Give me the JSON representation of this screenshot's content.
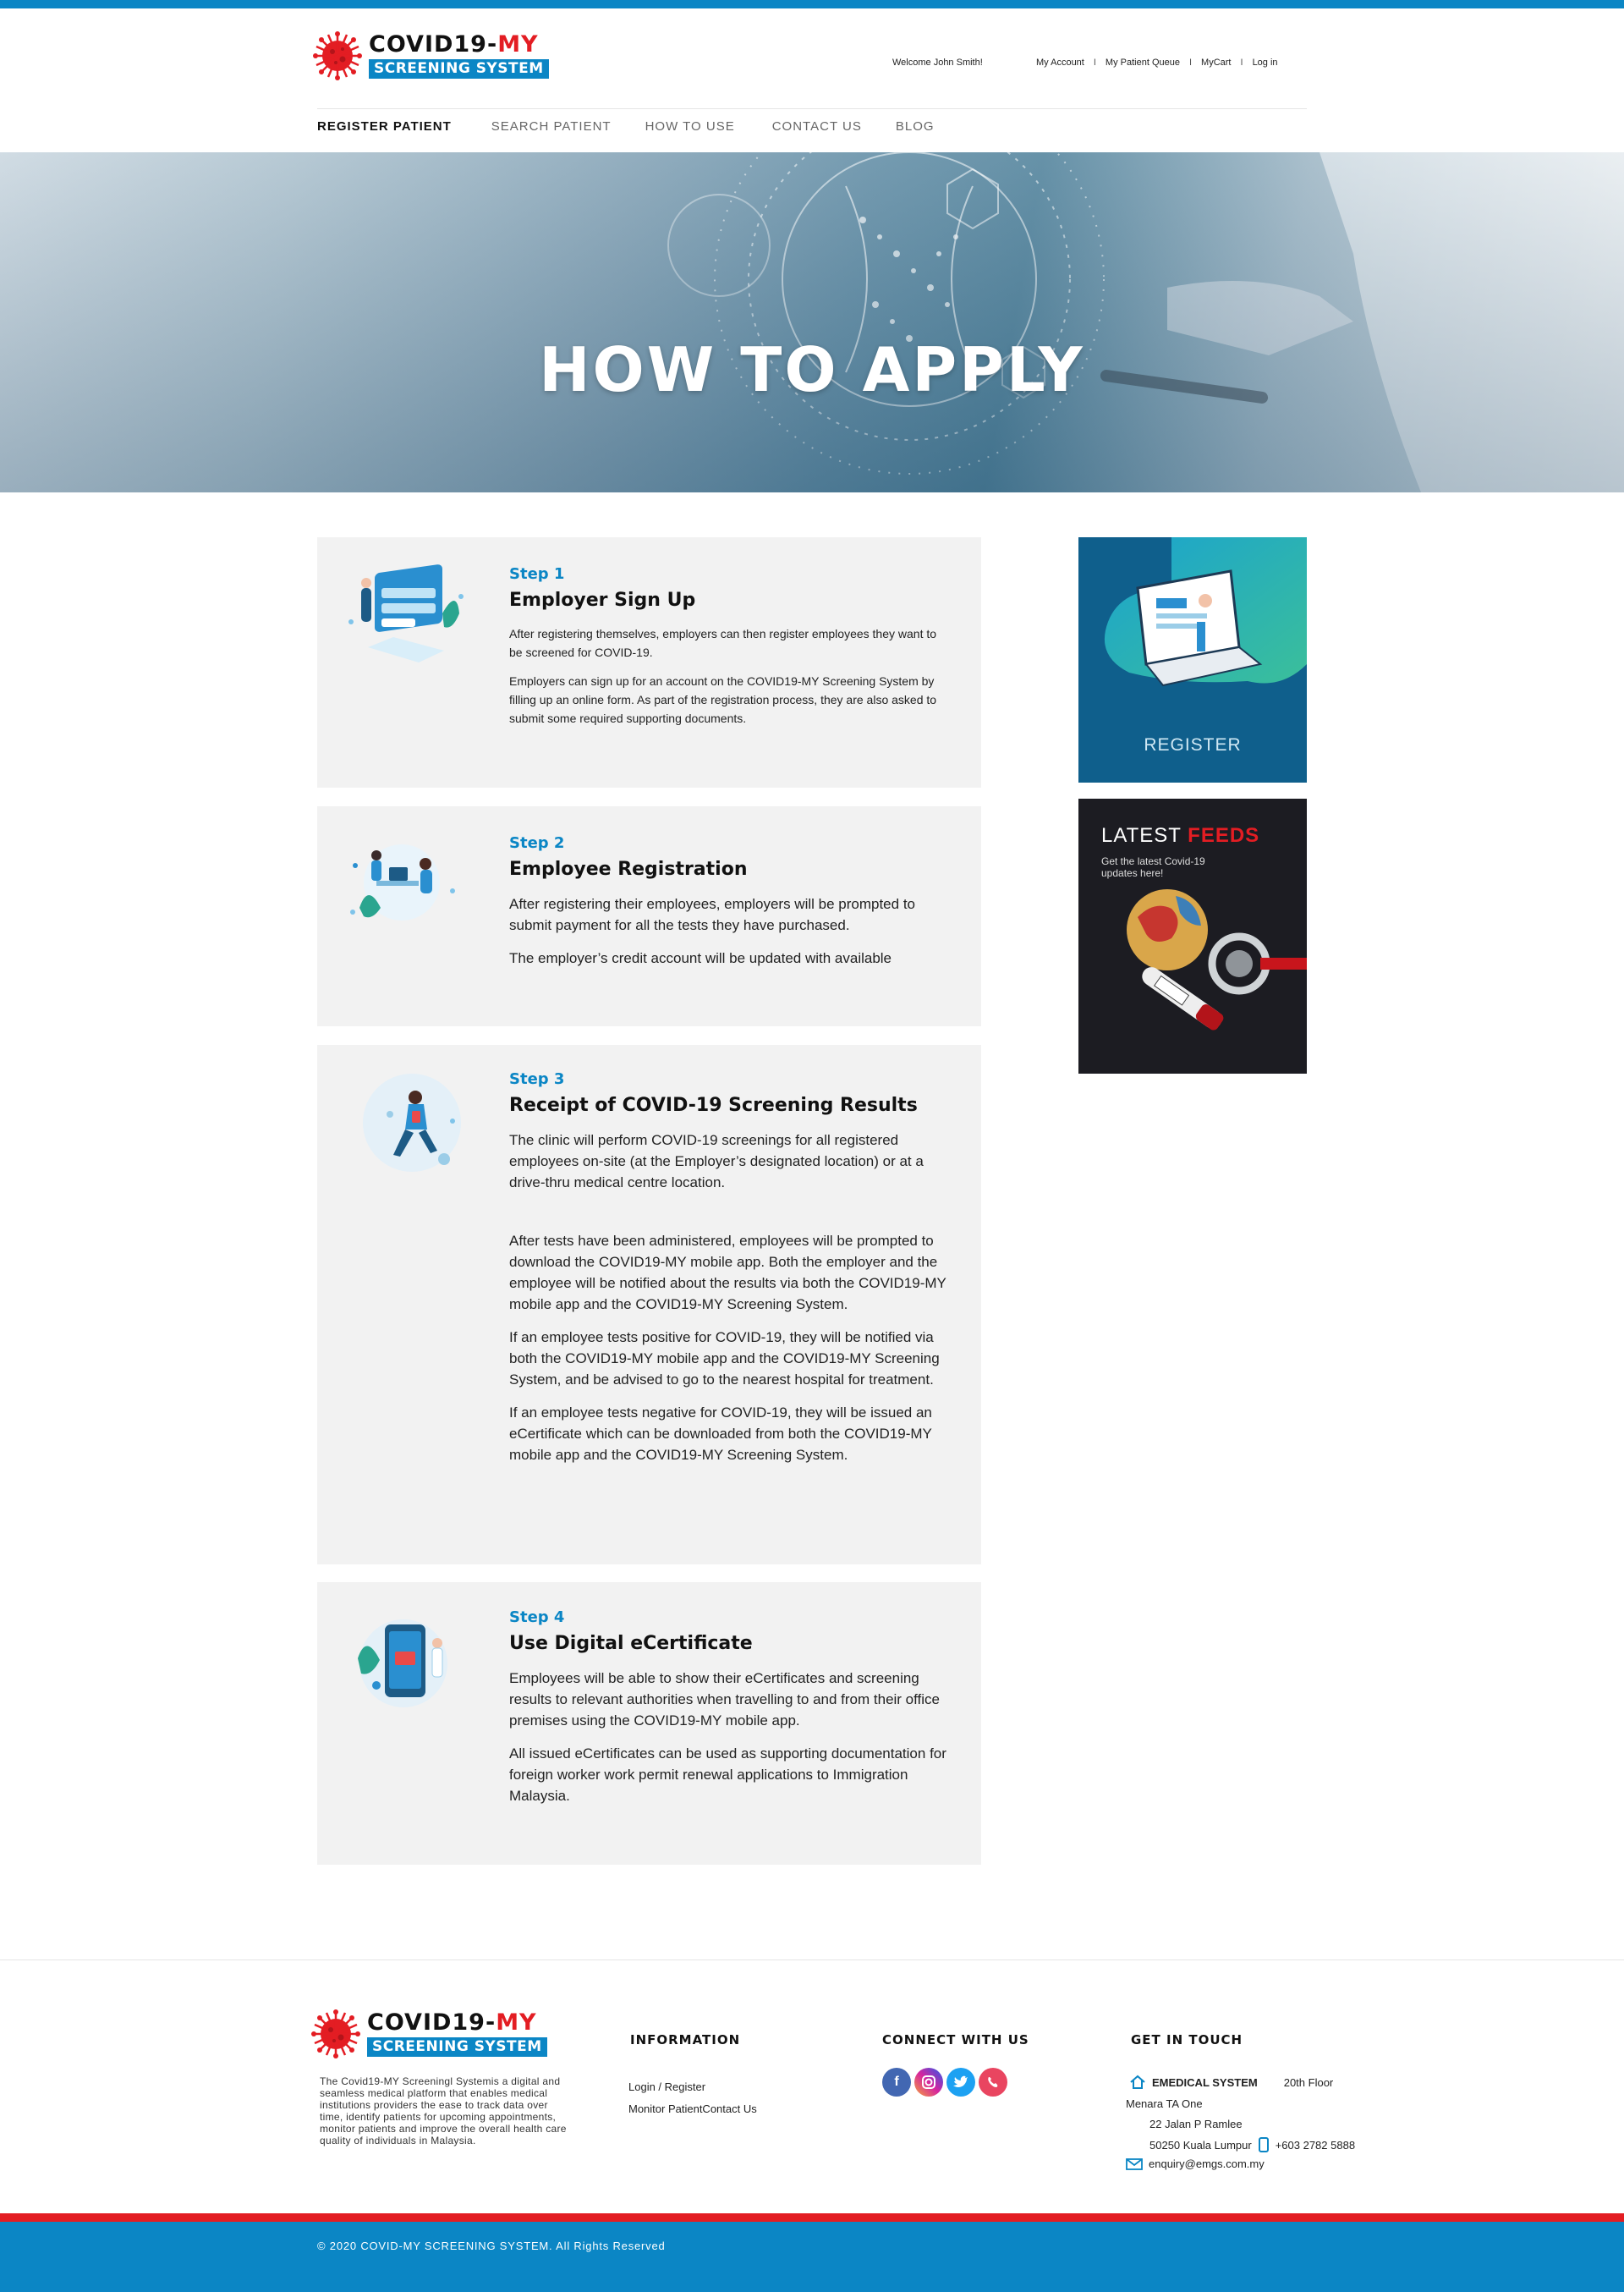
{
  "brand": {
    "name_main": "COVID19-",
    "name_red": "MY",
    "name_sub": "SCREENING SYSTEM"
  },
  "header": {
    "welcome": "Welcome John Smith!",
    "links": [
      "My Account",
      "My Patient Queue",
      "MyCart",
      "Log in"
    ],
    "nav": [
      "REGISTER PATIENT",
      "SEARCH PATIENT",
      "HOW TO USE",
      "CONTACT US",
      "BLOG"
    ]
  },
  "hero": {
    "title": "HOW TO APPLY"
  },
  "steps": [
    {
      "step": "Step 1",
      "title": "Employer Sign Up",
      "paras": [
        "After registering themselves, employers can then register employees they want to be screened for COVID-19.",
        "Employers can sign up for an account on the COVID19-MY Screening System by filling up an online form. As part of the registration process, they are also asked to submit some required supporting documents."
      ]
    },
    {
      "step": "Step 2",
      "title": "Employee Registration",
      "paras": [
        "After registering their employees, employers will be prompted to submit payment for all the tests they have purchased.",
        "The employer’s credit account will be updated with available"
      ]
    },
    {
      "step": "Step 3",
      "title": "Receipt of COVID-19 Screening Results",
      "paras": [
        "The clinic will perform COVID-19 screenings for all registered employees on-site (at the Employer’s designated location) or at a drive-thru medical centre location.",
        "After tests have been administered, employees will be prompted to download the COVID19-MY mobile app. Both the employer and the employee will be notified about the results via both the COVID19-MY mobile app and the COVID19-MY Screening System.",
        "If an employee tests positive for COVID-19, they will be notified via both the COVID19-MY mobile app and the COVID19-MY Screening System, and be advised to go to the nearest hospital for treatment.",
        "If an employee tests negative for COVID-19, they will be issued an eCertificate which can be downloaded from both the COVID19-MY mobile app and the COVID19-MY Screening System."
      ]
    },
    {
      "step": "Step 4",
      "title": "Use Digital eCertificate",
      "paras": [
        "Employees will be able to show their eCertificates and screening results to relevant authorities when travelling to and from their office premises using the COVID19-MY mobile app.",
        "All issued eCertificates can be used as supporting documentation for foreign worker work permit renewal applications to Immigration Malaysia."
      ]
    }
  ],
  "sidebar": {
    "register_label": "REGISTER",
    "feeds_title_a": "LATEST ",
    "feeds_title_b": "FEEDS",
    "feeds_sub": "Get the latest Covid-19 updates here!"
  },
  "footer": {
    "about": "The Covid19-MY Screeningl Systemis a digital and seamless medical platform that enables medical institutions providers the ease to track data over time, identify patients for upcoming appointments, monitor patients and improve the overall health care quality of individuals in Malaysia.",
    "info_heading": "INFORMATION",
    "info_links": [
      "Login / Register",
      "Monitor PatientContact Us"
    ],
    "connect_heading": "CONNECT WITH US",
    "social": [
      "facebook-icon",
      "instagram-icon",
      "twitter-icon",
      "viber-icon"
    ],
    "touch_heading": "GET IN TOUCH",
    "company": "EMEDICAL SYSTEM",
    "floor": "20th Floor",
    "building": "Menara TA One",
    "street": "22 Jalan P Ramlee",
    "city": "50250 Kuala Lumpur",
    "phone": "+603 2782 5888",
    "email": "enquiry@emgs.com.my",
    "copyright": "© 2020 COVID-MY SCREENING SYSTEM. All Rights Reserved"
  },
  "colors": {
    "accent": "#0b86c5",
    "brand_red": "#e31d23"
  }
}
